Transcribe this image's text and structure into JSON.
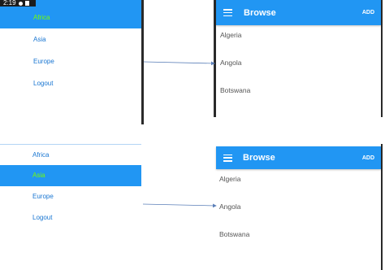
{
  "status": {
    "time": "2:19"
  },
  "drawer": {
    "items": [
      "Africa",
      "Asia",
      "Europe",
      "Logout"
    ]
  },
  "browse": {
    "title": "Browse",
    "action": "ADD",
    "countries": [
      "Algeria",
      "Angola",
      "Botswana"
    ]
  },
  "colors": {
    "primary": "#2196f3",
    "active_text": "#76ff03",
    "link": "#1976d2"
  }
}
